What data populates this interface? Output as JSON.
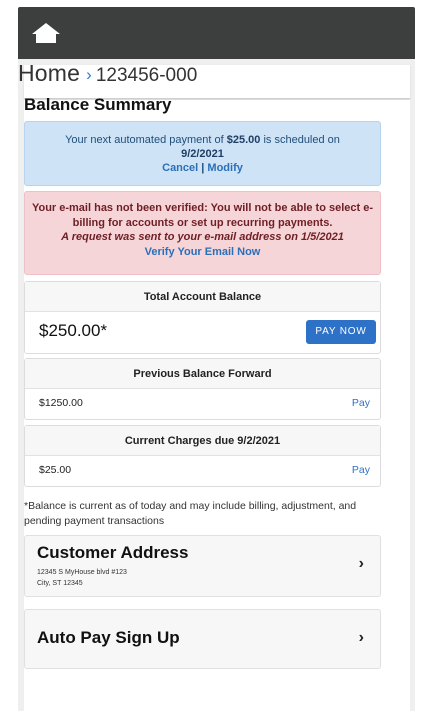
{
  "header": {
    "home_icon": "home-icon"
  },
  "breadcrumb": {
    "home": "Home",
    "separator": "›",
    "account": "123456-000"
  },
  "balance_summary": {
    "title": "Balance Summary"
  },
  "autopay_alert": {
    "prefix": "Your next automated payment of ",
    "amount": "$25.00",
    "middle": " is scheduled on",
    "date": "9/2/2021",
    "cancel": "Cancel",
    "divider": " | ",
    "modify": "Modify"
  },
  "email_alert": {
    "line1": "Your e-mail has not been verified: You will not be able to select e-billing for accounts or set up recurring payments.",
    "line2": "A request was sent to your e-mail address on 1/5/2021",
    "link": "Verify Your Email Now"
  },
  "total_balance": {
    "heading": "Total Account Balance",
    "amount": "$250.00*",
    "button": "PAY NOW"
  },
  "previous_balance": {
    "heading": "Previous Balance Forward",
    "amount": "$1250.00",
    "link": "Pay"
  },
  "current_charges": {
    "heading": "Current Charges due 9/2/2021",
    "amount": "$25.00",
    "link": "Pay"
  },
  "footnote": "*Balance is current as of today and may include billing, adjustment, and pending payment transactions",
  "customer_address": {
    "title": "Customer Address",
    "line1": "12345 S MyHouse blvd #123",
    "line2": "City, ST 12345",
    "chevron": "›"
  },
  "auto_pay": {
    "title": "Auto Pay Sign Up",
    "chevron": "›"
  },
  "colors": {
    "topbar": "#3d3e3e",
    "accent": "#2e72c7",
    "info_bg": "#cfe3f6",
    "danger_bg": "#f6d5d8"
  }
}
